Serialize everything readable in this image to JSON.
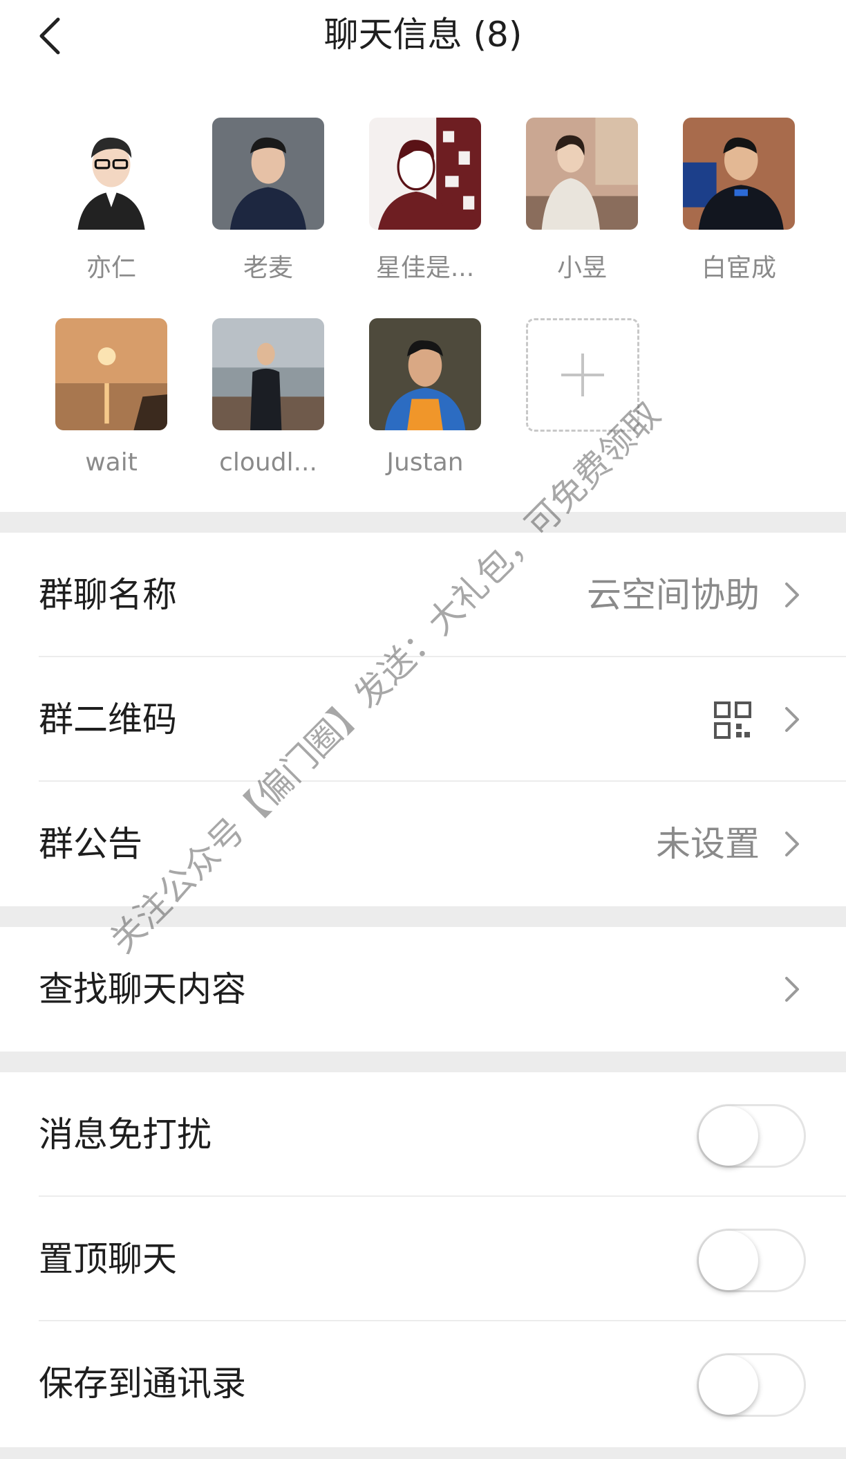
{
  "header": {
    "title": "聊天信息 (8)"
  },
  "members": [
    {
      "name": "亦仁"
    },
    {
      "name": "老麦"
    },
    {
      "name": "星佳是..."
    },
    {
      "name": "小昱"
    },
    {
      "name": "白宦成"
    },
    {
      "name": "wait"
    },
    {
      "name": "cloudl..."
    },
    {
      "name": "Justan"
    }
  ],
  "settings": {
    "group_name": {
      "label": "群聊名称",
      "value": "云空间协助"
    },
    "qr_code": {
      "label": "群二维码"
    },
    "announcement": {
      "label": "群公告",
      "value": "未设置"
    },
    "search_history": {
      "label": "查找聊天内容"
    },
    "mute": {
      "label": "消息免打扰",
      "on": false
    },
    "pin": {
      "label": "置顶聊天",
      "on": false
    },
    "save_contacts": {
      "label": "保存到通讯录",
      "on": false
    }
  },
  "watermark": "关注公众号【偏门圈】发送：大礼包，可免费领取"
}
